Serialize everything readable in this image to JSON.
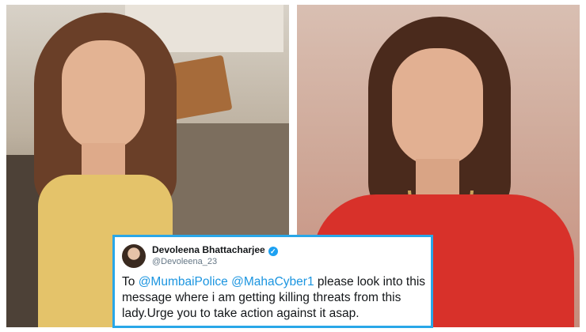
{
  "tweet": {
    "name": "Devoleena Bhattacharjee",
    "verified_icon": "✓",
    "handle": "@Devoleena_23",
    "text_prefix": "To ",
    "mention1": "@MumbaiPolice",
    "space": " ",
    "mention2": "@MahaCyber1",
    "text_body": " please look into this message where i am getting killing threats from this lady.Urge you to take action against it asap."
  },
  "colors": {
    "border": "#29a7e8",
    "mention": "#1b95e0",
    "verified": "#1da1f2"
  }
}
